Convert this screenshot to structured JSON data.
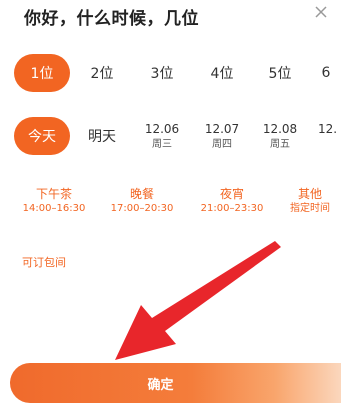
{
  "header": {
    "title": "你好，什么时候，几位"
  },
  "party_sizes": [
    "1位",
    "2位",
    "3位",
    "4位",
    "5位",
    "6"
  ],
  "dates": {
    "today": "今天",
    "tomorrow": "明天",
    "items": [
      {
        "date": "12.06",
        "weekday": "周三"
      },
      {
        "date": "12.07",
        "weekday": "周四"
      },
      {
        "date": "12.08",
        "weekday": "周五"
      },
      {
        "date": "12."
      }
    ]
  },
  "slots": [
    {
      "name": "下午茶",
      "time": "14:00–16:30"
    },
    {
      "name": "晚餐",
      "time": "17:00–20:30"
    },
    {
      "name": "夜宵",
      "time": "21:00–23:30"
    },
    {
      "name": "其他",
      "time": "指定时间"
    }
  ],
  "reserve_label": "可订包间",
  "confirm_label": "确定",
  "colors": {
    "accent": "#f26522",
    "arrow": "#e8262b"
  }
}
